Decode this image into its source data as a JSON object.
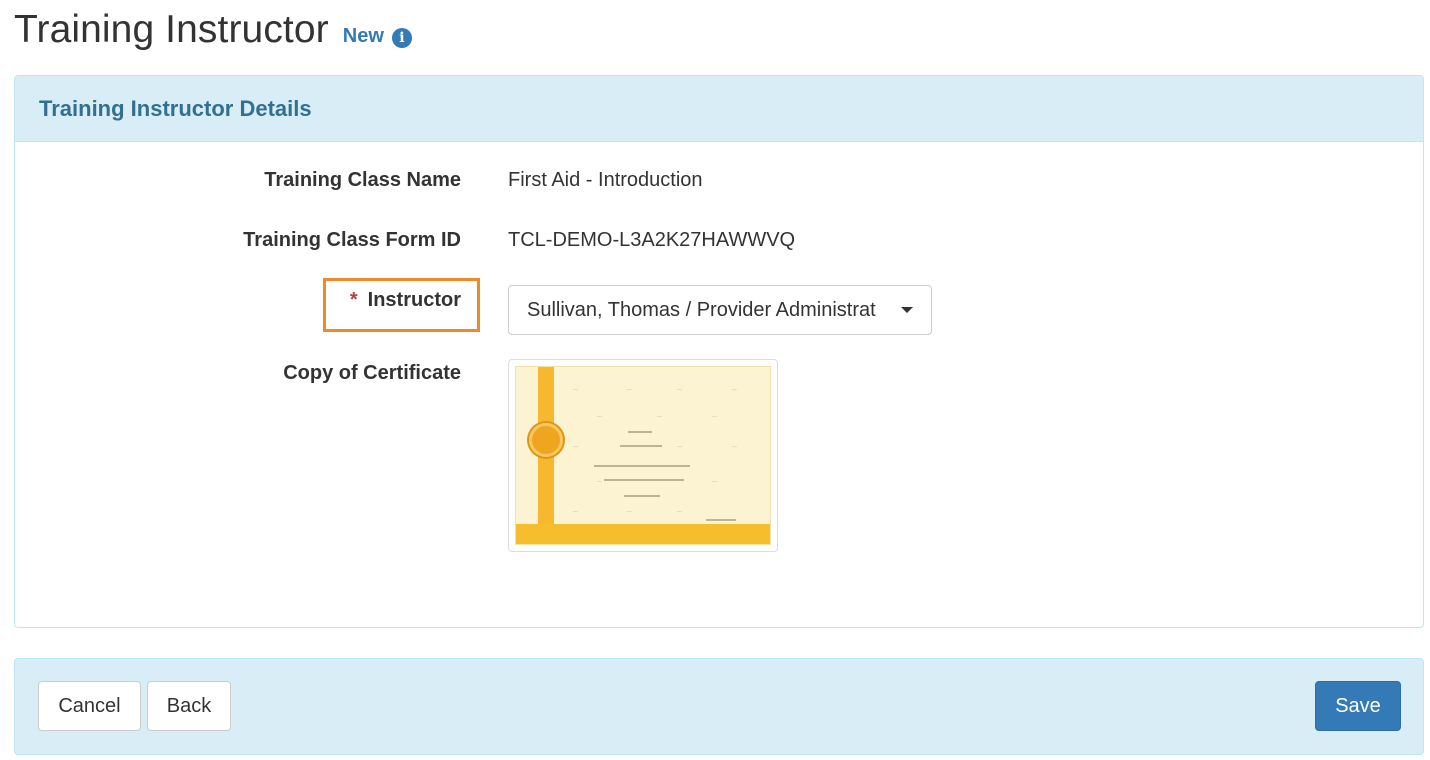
{
  "header": {
    "title": "Training Instructor",
    "badge": "New",
    "info_icon": "info-circle-icon"
  },
  "panel": {
    "title": "Training Instructor Details",
    "fields": {
      "class_name": {
        "label": "Training Class Name",
        "value": "First Aid - Introduction"
      },
      "form_id": {
        "label": "Training Class Form ID",
        "value": "TCL-DEMO-L3A2K27HAWWVQ"
      },
      "instructor": {
        "required_marker": "*",
        "label": "Instructor",
        "selected": "Sullivan, Thomas / Provider Administrat"
      },
      "certificate": {
        "label": "Copy of Certificate"
      }
    }
  },
  "footer": {
    "cancel_label": "Cancel",
    "back_label": "Back",
    "save_label": "Save"
  },
  "colors": {
    "primary": "#337ab7",
    "panel_heading_bg": "#d9edf7",
    "panel_heading_text": "#31708f",
    "highlight": "#f0892a",
    "required": "#a94442"
  }
}
